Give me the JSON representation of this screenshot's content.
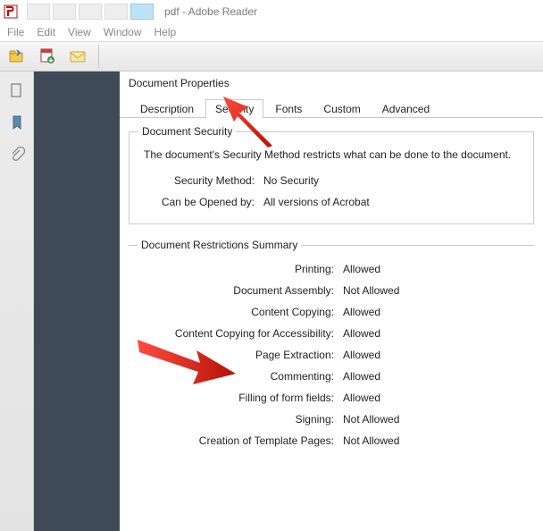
{
  "titlebar": {
    "title": "pdf - Adobe Reader"
  },
  "menubar": {
    "items": [
      "File",
      "Edit",
      "View",
      "Window",
      "Help"
    ]
  },
  "dialog": {
    "title": "Document Properties",
    "tabs": [
      "Description",
      "Security",
      "Fonts",
      "Custom",
      "Advanced"
    ],
    "active_tab_index": 1,
    "security": {
      "legend": "Document Security",
      "intro": "The document's Security Method restricts what can be done to the document.",
      "method_label": "Security Method:",
      "method_value": "No Security",
      "opened_label": "Can be Opened by:",
      "opened_value": "All versions of Acrobat"
    },
    "restrictions": {
      "legend": "Document Restrictions Summary",
      "rows": [
        {
          "k": "Printing:",
          "v": "Allowed"
        },
        {
          "k": "Document Assembly:",
          "v": "Not Allowed"
        },
        {
          "k": "Content Copying:",
          "v": "Allowed"
        },
        {
          "k": "Content Copying for Accessibility:",
          "v": "Allowed"
        },
        {
          "k": "Page Extraction:",
          "v": "Allowed"
        },
        {
          "k": "Commenting:",
          "v": "Allowed"
        },
        {
          "k": "Filling of form fields:",
          "v": "Allowed"
        },
        {
          "k": "Signing:",
          "v": "Not Allowed"
        },
        {
          "k": "Creation of Template Pages:",
          "v": "Not Allowed"
        }
      ]
    }
  }
}
